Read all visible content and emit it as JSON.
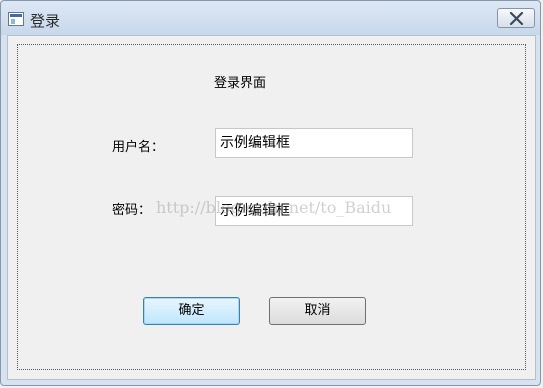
{
  "window": {
    "title": "登录",
    "close_icon": "close-icon"
  },
  "form": {
    "heading": "登录界面",
    "username_label": "用户名：",
    "username_value": "示例编辑框",
    "password_label": "密码：",
    "password_value": "示例编辑框",
    "watermark": "http://blog.csdn.net/to_Baidu"
  },
  "buttons": {
    "ok_label": "确定",
    "cancel_label": "取消"
  },
  "colors": {
    "titlebar": "#c7d8ec",
    "background": "#f0f0f0",
    "ok_border": "#3c7fb1"
  }
}
